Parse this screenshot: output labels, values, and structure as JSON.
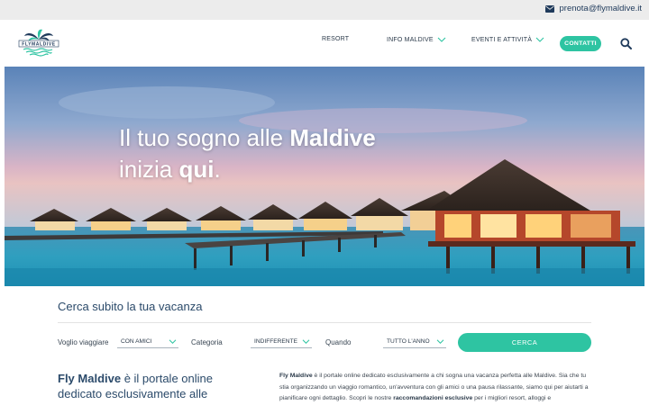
{
  "topbar": {
    "email": "prenota@flymaldive.it",
    "icon": "envelope-icon"
  },
  "brand": {
    "logo_text": "FLYMALDIVE",
    "accent": "#2ec4a2",
    "navy": "#1f3a5b"
  },
  "nav": {
    "resort": "RESORT",
    "info": "INFO MALDIVE",
    "eventi": "EVENTI E ATTIVITÀ",
    "contatti": "CONTATTI"
  },
  "hero": {
    "line1_pre": "Il tuo sogno alle ",
    "line1_bold": "Maldive",
    "line2_pre": "inizia ",
    "line2_bold": "qui",
    "line2_post": "."
  },
  "search": {
    "title": "Cerca subito la tua vacanza",
    "label_viaggiare": "Voglio viaggiare",
    "value_viaggiare": "CON AMICI",
    "label_categoria": "Categoria",
    "value_categoria": "INDIFFERENTE",
    "label_quando": "Quando",
    "value_quando": "TUTTO L'ANNO",
    "button": "CERCA"
  },
  "intro": {
    "left_bold": "Fly Maldive",
    "left_text": " è il portale online dedicato esclusivamente alle",
    "right_bold1": "Fly Maldive",
    "right_text1": " è il portale online dedicato esclusivamente a chi sogna una vacanza perfetta alle Maldive. Sia che tu stia organizzando un viaggio romantico, un'avventura con gli amici o una pausa rilassante, siamo qui per aiutarti a pianificare ogni dettaglio. Scopri le nostre ",
    "right_bold2": "raccomandazioni esclusive",
    "right_text2": " per i migliori resort, alloggi e"
  }
}
